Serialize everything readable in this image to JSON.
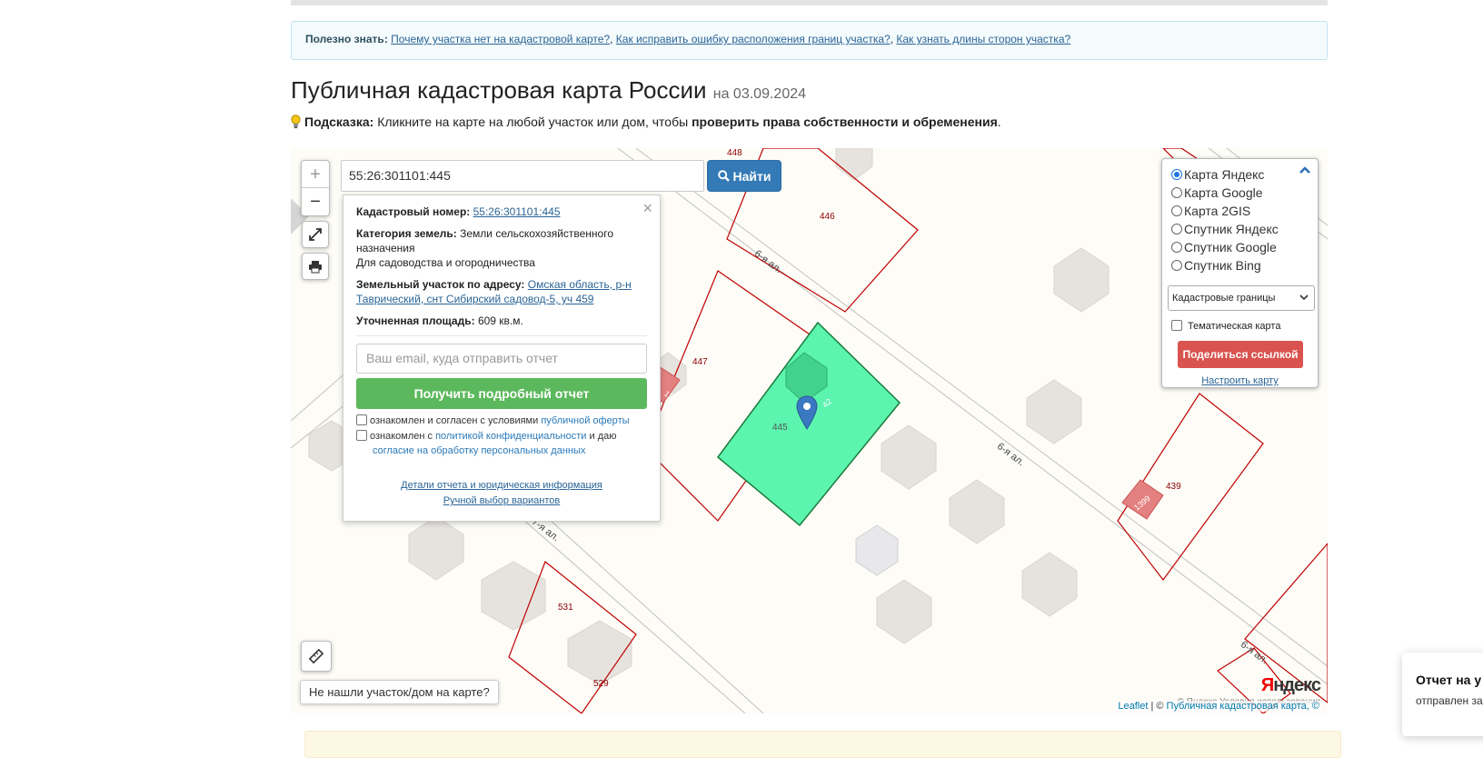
{
  "tip": {
    "label": "Полезно знать:",
    "links": [
      "Почему участка нет на кадастровой карте?",
      "Как исправить ошибку расположения границ участка?",
      "Как узнать длины сторон участка?"
    ]
  },
  "page": {
    "title": "Публичная кадастровая карта России",
    "date": "на 03.09.2024"
  },
  "hint": {
    "label": "Подсказка:",
    "text": "Кликните на карте на любой участок или дом, чтобы",
    "bold": "проверить права собственности и обременения",
    "end": "."
  },
  "map": {
    "zoom_in": "+",
    "zoom_out": "−",
    "search_value": "55:26:301101:445",
    "search_button": "Найти",
    "popup": {
      "close": "×",
      "cad_label": "Кадастровый номер:",
      "cad_value": "55:26:301101:445",
      "cat_label": "Категория земель:",
      "cat_value": "Земли сельскохозяйственного назначения",
      "use": "Для садоводства и огородничества",
      "addr_label": "Земельный участок по адресу:",
      "addr_value": "Омская область, р-н Таврический, снт Сибирский садовод-5, уч 459",
      "area_label": "Уточненная площадь:",
      "area_value": "609 кв.м.",
      "email_placeholder": "Ваш email, куда отправить отчет",
      "get_report": "Получить подробный отчет",
      "agree1_text": "ознакомлен и согласен с условиями",
      "agree1_link": "публичной оферты",
      "agree2_text": "ознакомлен с",
      "agree2_link": "политикой конфиденциальности",
      "agree2_mid": "и даю",
      "agree2_link2": "согласие на обработку персональных данных",
      "details_link": "Детали отчета и юридическая информация",
      "manual_link": "Ручной выбор вариантов"
    },
    "layers": {
      "options": [
        "Карта Яндекс",
        "Карта Google",
        "Карта 2GIS",
        "Спутник Яндекс",
        "Спутник Google",
        "Спутник Bing"
      ],
      "selected": "Карта Яндекс",
      "boundary_select": "Кадастровые границы",
      "thematic": "Тематическая карта",
      "share": "Поделиться ссылкой",
      "settings": "Настроить карту"
    },
    "labels": {
      "p448": "448",
      "p446": "446",
      "p447": "447",
      "p445": "445",
      "p439": "439",
      "p531": "531",
      "p529": "529",
      "b1202": "1202",
      "b1399": "1399",
      "b42": "42",
      "street1": "6-я ал.",
      "street2": "6-я ал.",
      "street3": "6-я ал.",
      "street4": "7-я ал."
    },
    "not_found": "Не нашли участок/дом на карте?",
    "ya_logo_1": "Я",
    "ya_logo_2": "ндекс",
    "ya_terms": "© Яндекс Условия использования",
    "attrib_leaflet": "Leaflet",
    "attrib_sep": "| ©",
    "attrib_pkk": "Публичная кадастровая карта, ©"
  },
  "toast": {
    "title": "Отчет на у",
    "body": "отправлен за"
  },
  "colors": {
    "selected_parcel": "#5cf5b0",
    "parcel_border": "#c00000",
    "primary": "#337ab7",
    "success": "#5cb85c",
    "danger": "#d9534f"
  }
}
